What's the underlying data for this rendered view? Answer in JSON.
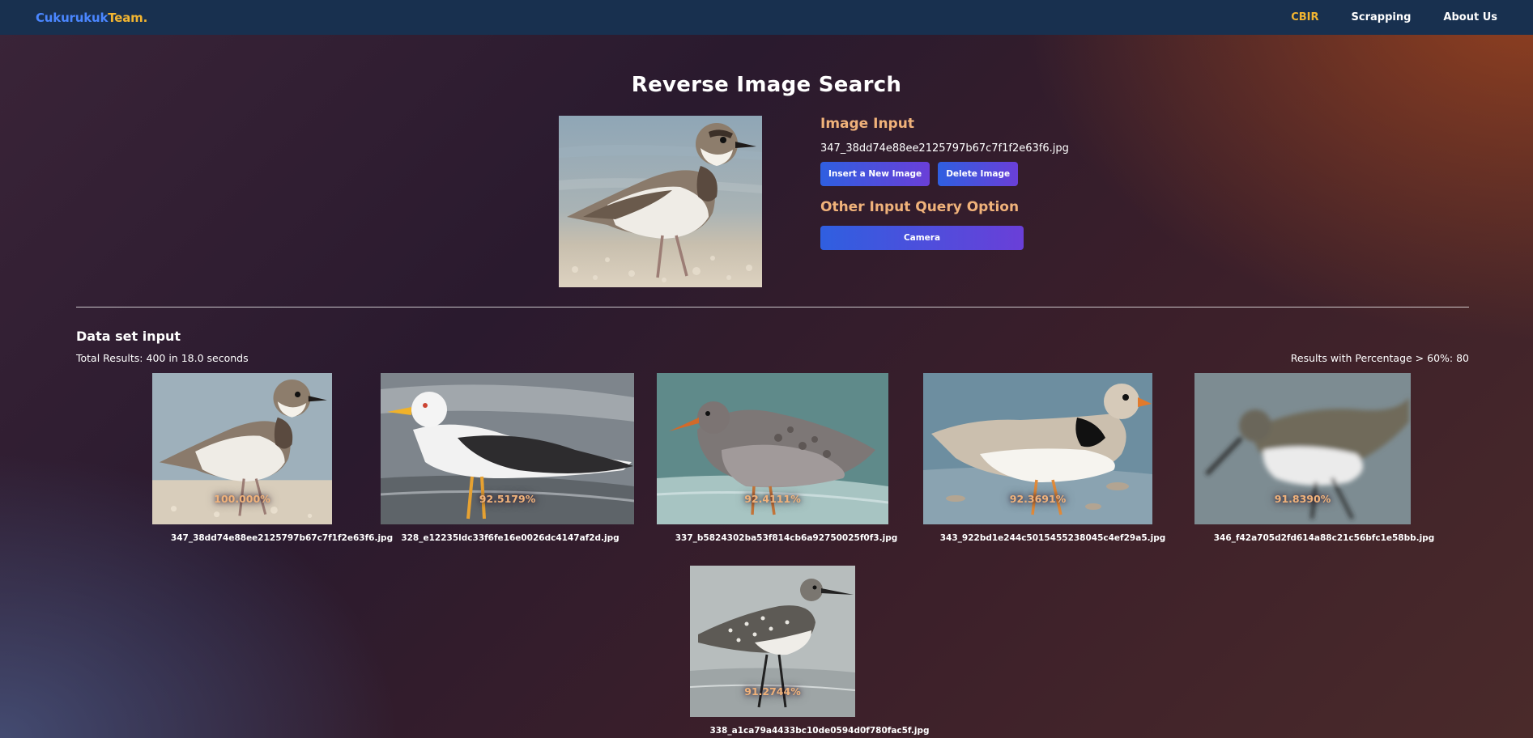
{
  "nav": {
    "brand_part1": "Cukurukuk",
    "brand_part2": "Team.",
    "links": [
      "CBIR",
      "Scrapping",
      "About Us"
    ],
    "active": "CBIR"
  },
  "title": "Reverse Image Search",
  "query": {
    "heading": "Image Input",
    "filename": "347_38dd74e88ee2125797b67c7f1f2e63f6.jpg",
    "insert_label": "Insert a New Image",
    "delete_label": "Delete Image",
    "other_heading": "Other Input Query Option",
    "camera_label": "Camera"
  },
  "dataset": {
    "heading": "Data set input",
    "total": "Total Results: 400 in 18.0 seconds",
    "pct_count": "Results with Percentage > 60%: 80"
  },
  "results": [
    {
      "score": "100.000%",
      "name": "347_38dd74e88ee2125797b67c7f1f2e63f6.jpg"
    },
    {
      "score": "92.5179%",
      "name": "328_e12235ldc33f6fe16e0026dc4147af2d.jpg"
    },
    {
      "score": "92.4111%",
      "name": "337_b5824302ba53f814cb6a92750025f0f3.jpg"
    },
    {
      "score": "92.3691%",
      "name": "343_922bd1e244c5015455238045c4ef29a5.jpg"
    },
    {
      "score": "91.8390%",
      "name": "346_f42a705d2fd614a88c21c56bfc1e58bb.jpg"
    },
    {
      "score": "91.2744%",
      "name": "338_a1ca79a4433bc10de0594d0f780fac5f.jpg"
    }
  ],
  "colors": {
    "navbar": "#18304f",
    "accent": "#f2b531",
    "heading_orange": "#f0b27a",
    "button_from": "#2f5fe0",
    "button_to": "#6a3fd8"
  }
}
